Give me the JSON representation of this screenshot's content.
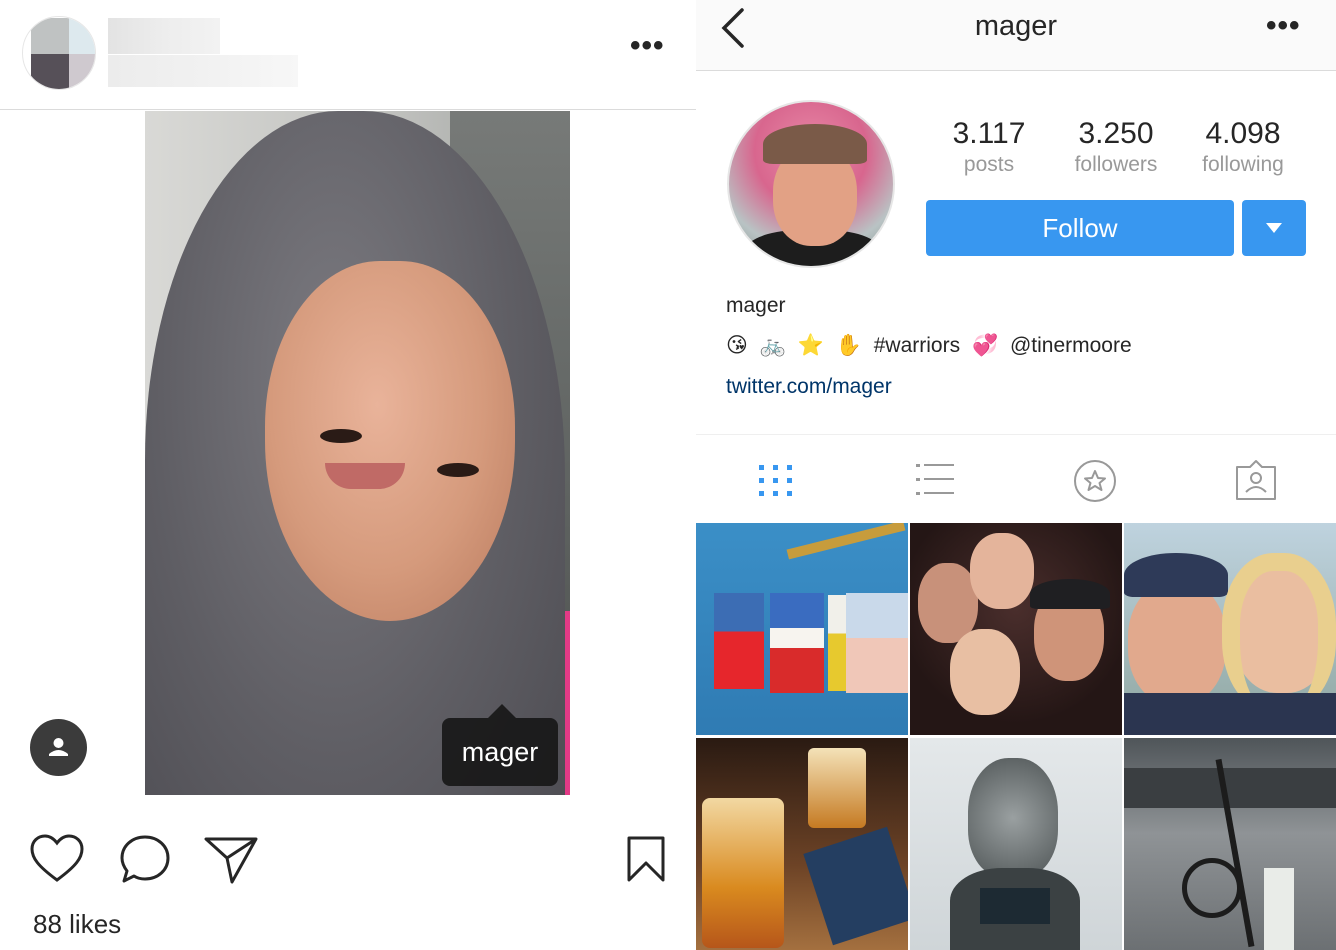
{
  "left_post": {
    "tag_label": "mager",
    "likes_text": "88 likes",
    "icons": {
      "more": "more-horizontal-icon",
      "like": "heart-icon",
      "comment": "comment-icon",
      "share": "send-icon",
      "save": "bookmark-icon",
      "tagged_people": "person-icon"
    }
  },
  "profile": {
    "header_title": "mager",
    "posts_count": "3.117",
    "posts_label": "posts",
    "followers_count": "3.250",
    "followers_label": "followers",
    "following_count": "4.098",
    "following_label": "following",
    "follow_label": "Follow",
    "bio_name": "mager",
    "bio_emojis": [
      "😘",
      "🚲",
      "⭐",
      "✋"
    ],
    "bio_hashtag": "#warriors",
    "bio_heart": "💞",
    "bio_mention": "@tinermoore",
    "bio_link": "twitter.com/mager",
    "colors": {
      "accent": "#3897f0",
      "link": "#003569",
      "tab_active": "#3897f0",
      "muted": "#999999"
    },
    "tabs": [
      "grid-icon",
      "list-icon",
      "star-icon",
      "tagged-photo-icon"
    ]
  }
}
